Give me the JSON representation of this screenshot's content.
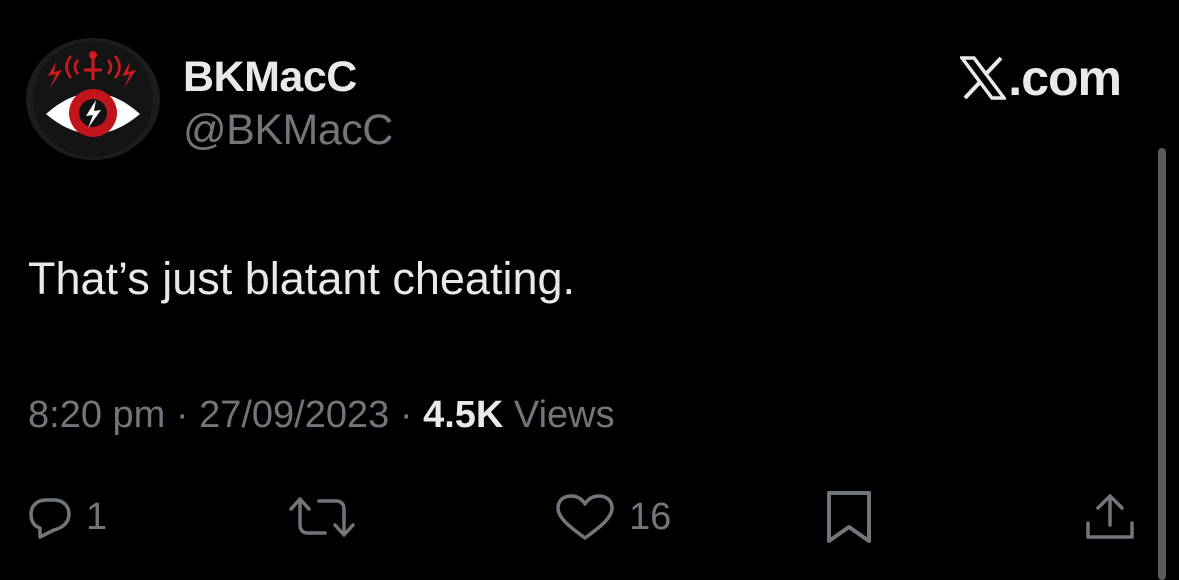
{
  "tweet": {
    "display_name": "BKMacC",
    "handle": "@BKMacC",
    "brand": ".com",
    "text": "That’s just blatant cheating.",
    "time": "8:20 pm",
    "separator": "·",
    "date": "27/09/2023",
    "views_count": "4.5K",
    "views_label": "Views"
  },
  "actions": {
    "replies": "1",
    "likes": "16"
  },
  "icons": {
    "reply": "reply-bubble-icon",
    "retweet": "retweet-icon",
    "like": "heart-icon",
    "bookmark": "bookmark-icon",
    "share": "share-icon",
    "brand": "x-logo-icon"
  },
  "colors": {
    "background": "#000000",
    "primary_text": "#e7e9ea",
    "secondary_text": "#71767b",
    "avatar_red": "#c0151a"
  }
}
